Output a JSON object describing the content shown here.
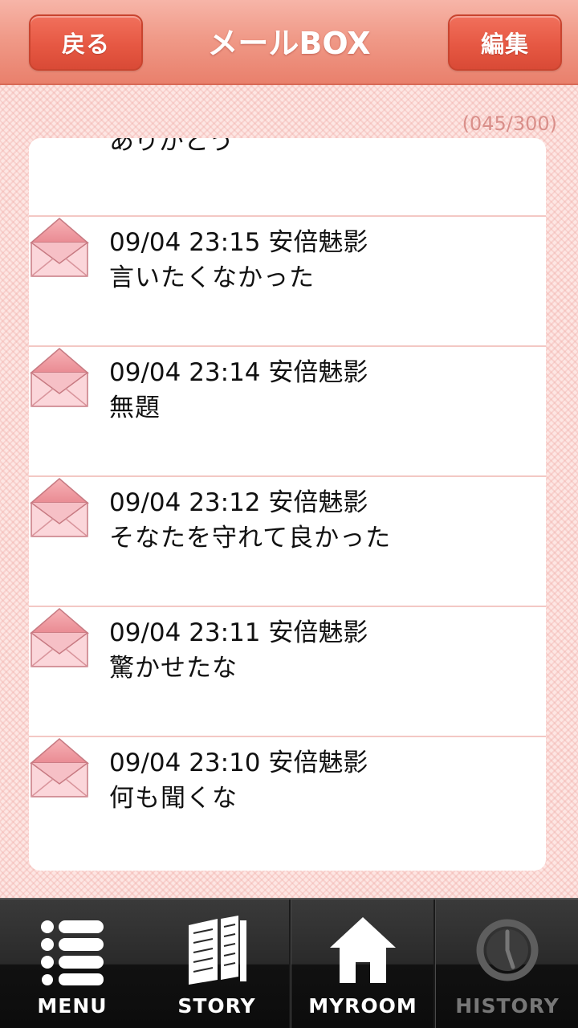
{
  "header": {
    "back_label": "戻る",
    "title": "メールBOX",
    "edit_label": "編集"
  },
  "counter": "(045/300)",
  "partial_item": {
    "subject": "ありがとう"
  },
  "mails": [
    {
      "datetime": "09/04 23:15",
      "sender": "安倍魅影",
      "subject": "言いたくなかった"
    },
    {
      "datetime": "09/04 23:14",
      "sender": "安倍魅影",
      "subject": "無題"
    },
    {
      "datetime": "09/04 23:12",
      "sender": "安倍魅影",
      "subject": "そなたを守れて良かった"
    },
    {
      "datetime": "09/04 23:11",
      "sender": "安倍魅影",
      "subject": "驚かせたな"
    },
    {
      "datetime": "09/04 23:10",
      "sender": "安倍魅影",
      "subject": "何も聞くな"
    }
  ],
  "nav": {
    "items": [
      {
        "label": "MENU",
        "icon": "menu-list-icon",
        "state": "active"
      },
      {
        "label": "STORY",
        "icon": "book-icon",
        "state": "active"
      },
      {
        "label": "MYROOM",
        "icon": "house-icon",
        "state": "active"
      },
      {
        "label": "HISTORY",
        "icon": "clock-icon",
        "state": "disabled"
      }
    ]
  },
  "colors": {
    "header_button": "#e65843",
    "accent_pink": "#f3c8c4",
    "counter_text": "#d98f8a",
    "envelope_fill": "#f9c9ce"
  }
}
